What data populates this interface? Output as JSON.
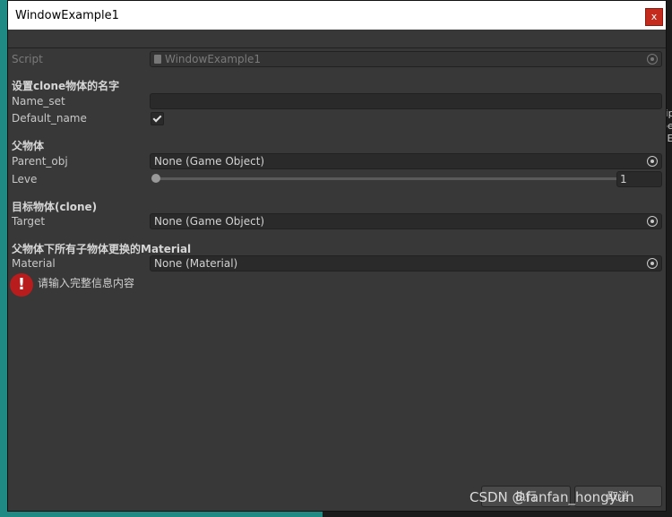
{
  "window": {
    "title": "WindowExample1",
    "close_label": "x"
  },
  "script_field": {
    "label": "Script",
    "value": "WindowExample1"
  },
  "section_name": {
    "header": "设置clone物体的名字",
    "name_set_label": "Name_set",
    "name_set_value": "",
    "default_name_label": "Default_name",
    "default_name_checked": true
  },
  "section_parent": {
    "header": "父物体",
    "parent_obj_label": "Parent_obj",
    "parent_obj_value": "None (Game Object)",
    "leve_label": "Leve",
    "leve_value": "1"
  },
  "section_target": {
    "header": "目标物体(clone)",
    "target_label": "Target",
    "target_value": "None (Game Object)"
  },
  "section_material": {
    "header": "父物体下所有子物体更换的Material",
    "material_label": "Material",
    "material_value": "None (Material)"
  },
  "error": {
    "icon": "!",
    "message": "请输入完整信息内容"
  },
  "buttons": {
    "execute_label": "执行",
    "cancel_label": "取消"
  },
  "background": {
    "peek_lines": [
      "rip",
      "pe",
      "vE"
    ]
  },
  "watermark": "CSDN @fanfan_hongyun",
  "colors": {
    "window_bg": "#383838",
    "field_bg": "#2a2a2a",
    "error_red": "#b81c1c",
    "close_red": "#c42b1c"
  }
}
